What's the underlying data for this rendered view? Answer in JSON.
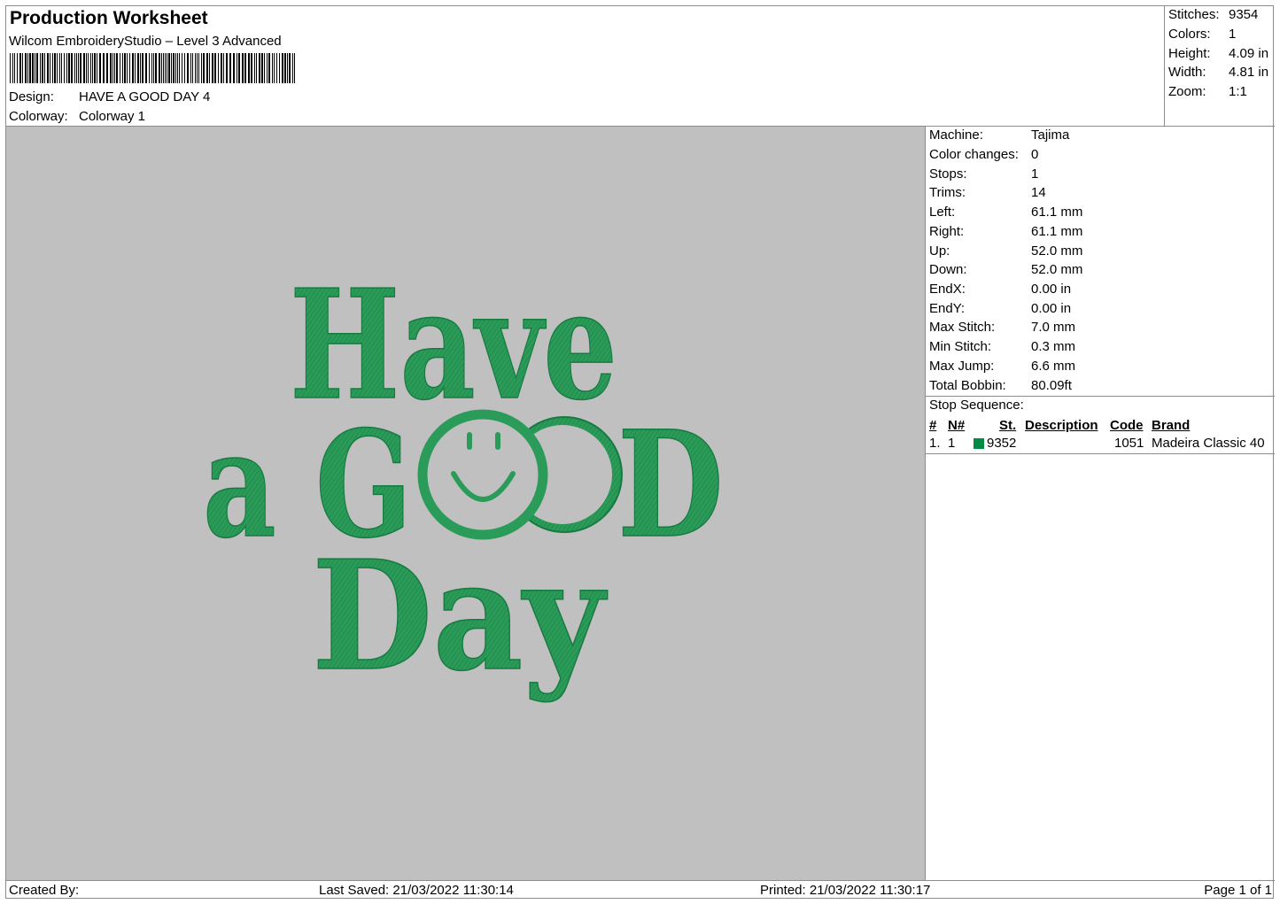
{
  "header": {
    "title": "Production Worksheet",
    "subtitle": "Wilcom EmbroideryStudio – Level 3 Advanced",
    "design_label": "Design:",
    "design_value": "HAVE A GOOD DAY 4",
    "colorway_label": "Colorway:",
    "colorway_value": "Colorway 1"
  },
  "stats": {
    "stitches_label": "Stitches:",
    "stitches": "9354",
    "colors_label": "Colors:",
    "colors": "1",
    "height_label": "Height:",
    "height": "4.09 in",
    "width_label": "Width:",
    "width": "4.81 in",
    "zoom_label": "Zoom:",
    "zoom": "1:1"
  },
  "design": {
    "line1": "Have",
    "line2a": "a G",
    "line2b": "D",
    "line3": "Day",
    "thread_color": "#2a9b58",
    "background_color": "#c0c0c0"
  },
  "machine_info": {
    "machine_label": "Machine:",
    "machine": "Tajima",
    "color_changes_label": "Color changes:",
    "color_changes": "0",
    "stops_label": "Stops:",
    "stops": "1",
    "trims_label": "Trims:",
    "trims": "14",
    "left_label": "Left:",
    "left": "61.1 mm",
    "right_label": "Right:",
    "right": "61.1 mm",
    "up_label": "Up:",
    "up": "52.0 mm",
    "down_label": "Down:",
    "down": "52.0 mm",
    "endx_label": "EndX:",
    "endx": "0.00 in",
    "endy_label": "EndY:",
    "endy": "0.00 in",
    "max_stitch_label": "Max Stitch:",
    "max_stitch": "7.0 mm",
    "min_stitch_label": "Min Stitch:",
    "min_stitch": "0.3 mm",
    "max_jump_label": "Max Jump:",
    "max_jump": "6.6 mm",
    "total_bobbin_label": "Total Bobbin:",
    "total_bobbin": "80.09ft"
  },
  "stop_sequence": {
    "title": "Stop Sequence:",
    "headers": {
      "num": "#",
      "n": "N#",
      "st": "St.",
      "description": "Description",
      "code": "Code",
      "brand": "Brand"
    },
    "rows": [
      {
        "num": "1.",
        "n": "1",
        "swatch_color": "#008c46",
        "st": "9352",
        "description": "",
        "code": "1051",
        "brand": "Madeira Classic 40"
      }
    ]
  },
  "footer": {
    "created_by": "Created By:",
    "last_saved": "Last Saved: 21/03/2022 11:30:14",
    "printed": "Printed: 21/03/2022 11:30:17",
    "page": "Page 1 of 1"
  }
}
